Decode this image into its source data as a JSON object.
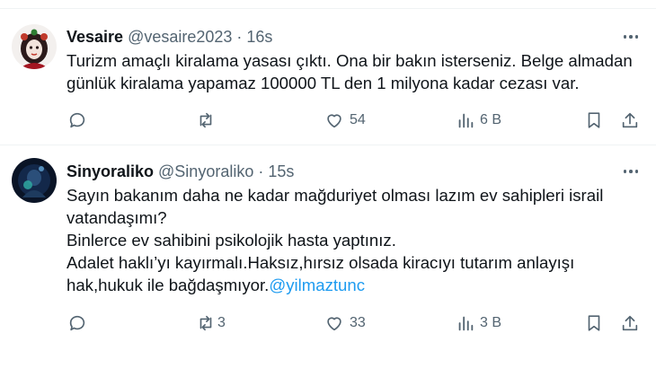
{
  "tweets": [
    {
      "name": "Vesaire",
      "handle": "@vesaire2023",
      "separator": "·",
      "time": "16s",
      "lines": [
        "Turizm amaçlı kiralama yasası çıktı. Ona bir bakın isterseniz. Belge almadan",
        "günlük kiralama yapamaz 100000 TL den 1 milyona kadar cezası var."
      ],
      "mention": "",
      "actions": {
        "reply": "",
        "retweet": "",
        "like": "54",
        "views": "6 B"
      }
    },
    {
      "name": "Sinyoraliko",
      "handle": "@Sinyoraliko",
      "separator": "·",
      "time": "15s",
      "lines": [
        "Sayın bakanım daha ne kadar mağduriyet olması lazım ev sahipleri israil",
        "vatandaşımı?",
        "Binlerce ev sahibini psikolojik hasta yaptınız.",
        "Adalet haklı’yı kayırmalı.Haksız,hırsız olsada kiracıyı tutarım anlayışı",
        "hak,hukuk ile bağdaşmıyor."
      ],
      "mention": "@yilmaztunc",
      "actions": {
        "reply": "",
        "retweet": "3",
        "like": "33",
        "views": "3 B"
      }
    }
  ],
  "colors": {
    "text": "#0f1419",
    "secondary": "#536471",
    "link": "#1d9bf0",
    "divider": "#eff3f4"
  },
  "icons": [
    "reply-icon",
    "retweet-icon",
    "like-icon",
    "views-icon",
    "bookmark-icon",
    "share-icon",
    "more-icon"
  ]
}
